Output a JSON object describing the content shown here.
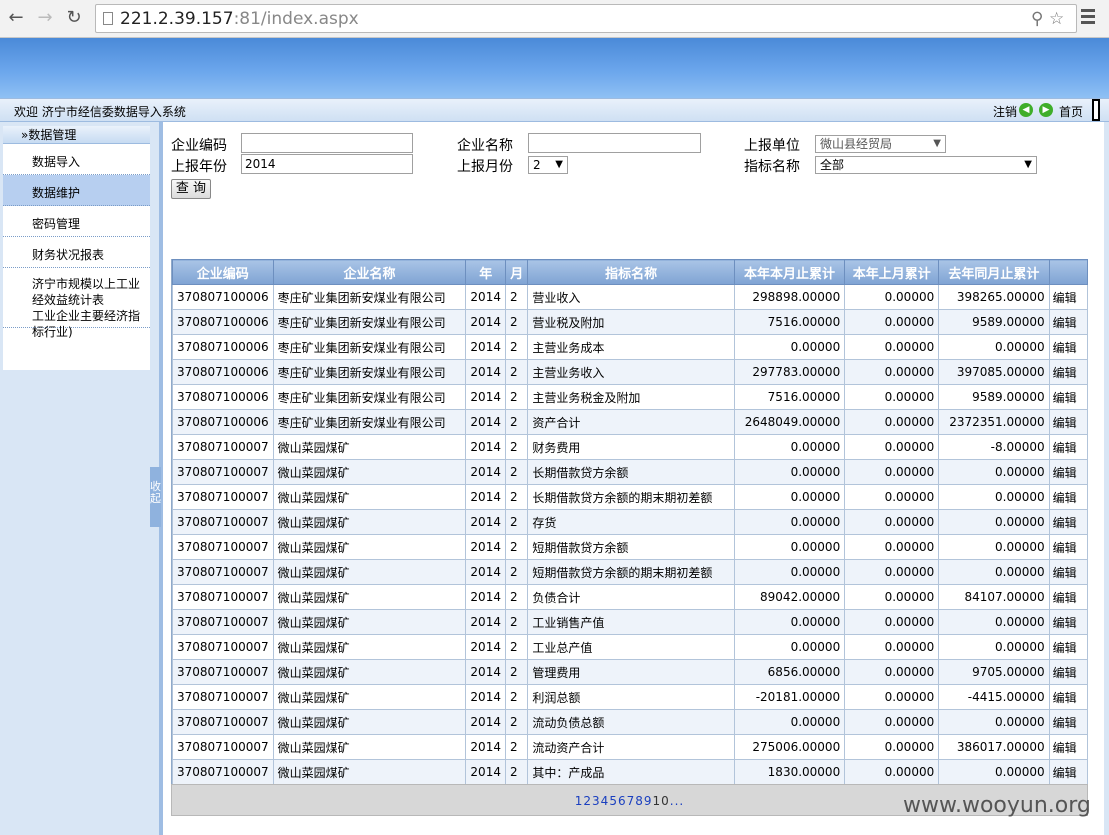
{
  "browser": {
    "url_host": "221.2.39.157",
    "url_port_path": ":81/index.aspx"
  },
  "header": {
    "welcome": "欢迎 济宁市经信委数据导入系统",
    "logout": "注销",
    "home": "首页"
  },
  "sidebar": {
    "section_title": "»数据管理",
    "items": [
      {
        "label": "数据导入"
      },
      {
        "label": "数据维护"
      },
      {
        "label": "密码管理"
      },
      {
        "label": "财务状况报表"
      },
      {
        "label": "济宁市规模以上工业经效益统计表"
      },
      {
        "label": "工业企业主要经济指标行业)"
      }
    ],
    "collapse_label": "收起"
  },
  "filters": {
    "company_code_label": "企业编码",
    "company_code_value": "",
    "company_name_label": "企业名称",
    "company_name_value": "",
    "report_unit_label": "上报单位",
    "report_unit_value": "微山县经贸局",
    "report_year_label": "上报年份",
    "report_year_value": "2014",
    "report_month_label": "上报月份",
    "report_month_value": "2",
    "indicator_label": "指标名称",
    "indicator_value": "全部",
    "query_button": "查 询"
  },
  "table": {
    "columns": [
      "企业编码",
      "企业名称",
      "年",
      "月",
      "指标名称",
      "本年本月止累计",
      "本年上月累计",
      "去年同月止累计",
      ""
    ],
    "edit_label": "编辑",
    "rows": [
      [
        "370807100006",
        "枣庄矿业集团新安煤业有限公司",
        "2014",
        "2",
        "营业收入",
        "298898.00000",
        "0.00000",
        "398265.00000"
      ],
      [
        "370807100006",
        "枣庄矿业集团新安煤业有限公司",
        "2014",
        "2",
        "营业税及附加",
        "7516.00000",
        "0.00000",
        "9589.00000"
      ],
      [
        "370807100006",
        "枣庄矿业集团新安煤业有限公司",
        "2014",
        "2",
        "主营业务成本",
        "0.00000",
        "0.00000",
        "0.00000"
      ],
      [
        "370807100006",
        "枣庄矿业集团新安煤业有限公司",
        "2014",
        "2",
        "主营业务收入",
        "297783.00000",
        "0.00000",
        "397085.00000"
      ],
      [
        "370807100006",
        "枣庄矿业集团新安煤业有限公司",
        "2014",
        "2",
        "主营业务税金及附加",
        "7516.00000",
        "0.00000",
        "9589.00000"
      ],
      [
        "370807100006",
        "枣庄矿业集团新安煤业有限公司",
        "2014",
        "2",
        "资产合计",
        "2648049.00000",
        "0.00000",
        "2372351.00000"
      ],
      [
        "370807100007",
        "微山菜园煤矿",
        "2014",
        "2",
        "财务费用",
        "0.00000",
        "0.00000",
        "-8.00000"
      ],
      [
        "370807100007",
        "微山菜园煤矿",
        "2014",
        "2",
        "长期借款贷方余额",
        "0.00000",
        "0.00000",
        "0.00000"
      ],
      [
        "370807100007",
        "微山菜园煤矿",
        "2014",
        "2",
        "长期借款贷方余额的期末期初差额",
        "0.00000",
        "0.00000",
        "0.00000"
      ],
      [
        "370807100007",
        "微山菜园煤矿",
        "2014",
        "2",
        "存货",
        "0.00000",
        "0.00000",
        "0.00000"
      ],
      [
        "370807100007",
        "微山菜园煤矿",
        "2014",
        "2",
        "短期借款贷方余额",
        "0.00000",
        "0.00000",
        "0.00000"
      ],
      [
        "370807100007",
        "微山菜园煤矿",
        "2014",
        "2",
        "短期借款贷方余额的期末期初差额",
        "0.00000",
        "0.00000",
        "0.00000"
      ],
      [
        "370807100007",
        "微山菜园煤矿",
        "2014",
        "2",
        "负债合计",
        "89042.00000",
        "0.00000",
        "84107.00000"
      ],
      [
        "370807100007",
        "微山菜园煤矿",
        "2014",
        "2",
        "工业销售产值",
        "0.00000",
        "0.00000",
        "0.00000"
      ],
      [
        "370807100007",
        "微山菜园煤矿",
        "2014",
        "2",
        "工业总产值",
        "0.00000",
        "0.00000",
        "0.00000"
      ],
      [
        "370807100007",
        "微山菜园煤矿",
        "2014",
        "2",
        "管理费用",
        "6856.00000",
        "0.00000",
        "9705.00000"
      ],
      [
        "370807100007",
        "微山菜园煤矿",
        "2014",
        "2",
        "利润总额",
        "-20181.00000",
        "0.00000",
        "-4415.00000"
      ],
      [
        "370807100007",
        "微山菜园煤矿",
        "2014",
        "2",
        "流动负债总额",
        "0.00000",
        "0.00000",
        "0.00000"
      ],
      [
        "370807100007",
        "微山菜园煤矿",
        "2014",
        "2",
        "流动资产合计",
        "275006.00000",
        "0.00000",
        "386017.00000"
      ],
      [
        "370807100007",
        "微山菜园煤矿",
        "2014",
        "2",
        "其中：产成品",
        "1830.00000",
        "0.00000",
        "0.00000"
      ]
    ]
  },
  "pager": {
    "pages": [
      "1",
      "2",
      "3",
      "4",
      "5",
      "6",
      "7",
      "8",
      "9"
    ],
    "current": "10",
    "more": "..."
  },
  "watermark": "www.wooyun.org"
}
